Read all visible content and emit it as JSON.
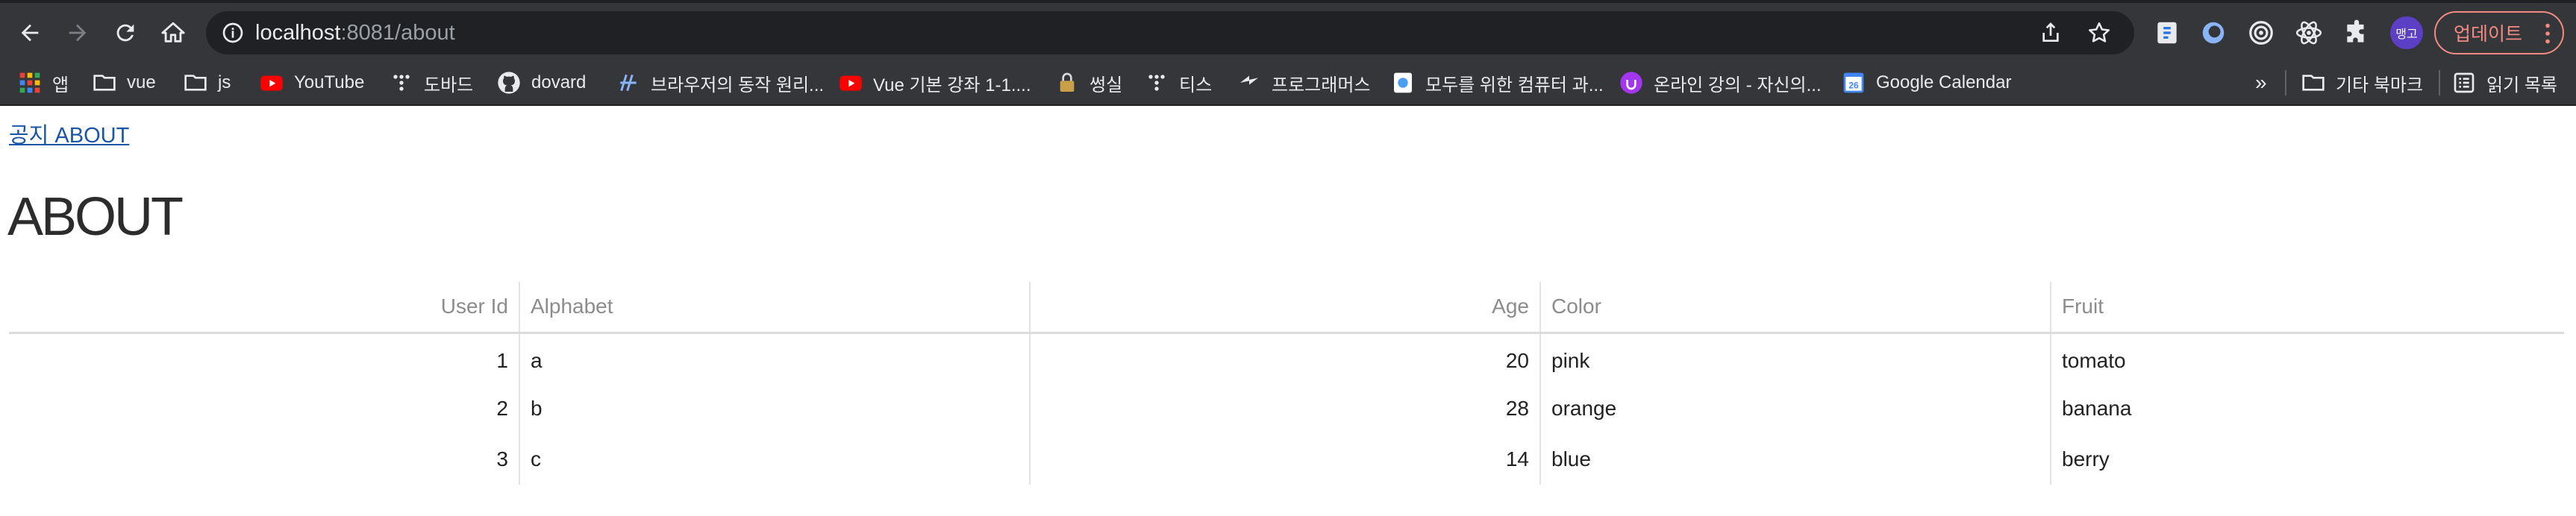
{
  "browser": {
    "url_host": "localhost",
    "url_path": ":8081/about",
    "profile_label": "맹고",
    "update_label": "업데이트",
    "icons": [
      "back-icon",
      "forward-icon",
      "reload-icon",
      "home-icon",
      "info-icon",
      "share-icon",
      "star-icon",
      "puzzle-icon",
      "more-icon"
    ]
  },
  "bookmarks": {
    "items": [
      {
        "label": "앱",
        "icon": "apps-grid-icon"
      },
      {
        "label": "vue",
        "icon": "folder-icon"
      },
      {
        "label": "js",
        "icon": "folder-icon"
      },
      {
        "label": "YouTube",
        "icon": "youtube-icon"
      },
      {
        "label": "도바드",
        "icon": "dots-icon"
      },
      {
        "label": "dovard",
        "icon": "github-icon"
      },
      {
        "label": "브라우저의 동작 원리...",
        "icon": "site-icon"
      },
      {
        "label": "Vue 기본 강좌 1-1....",
        "icon": "youtube-icon"
      },
      {
        "label": "썽실",
        "icon": "lock-icon"
      },
      {
        "label": "티스",
        "icon": "dots-icon"
      },
      {
        "label": "프로그래머스",
        "icon": "programmers-icon"
      },
      {
        "label": "모두를 위한 컴퓨터 과...",
        "icon": "doc-icon"
      },
      {
        "label": "온라인 강의 - 자신의...",
        "icon": "udemy-icon"
      },
      {
        "label": "Google Calendar",
        "icon": "calendar-icon"
      }
    ],
    "overflow": "»",
    "other_label": "기타 북마크",
    "reading_label": "읽기 목록",
    "calendar_day": "26"
  },
  "page": {
    "link_text": "공지 ABOUT",
    "title": "ABOUT"
  },
  "table": {
    "headers": [
      "User Id",
      "Alphabet",
      "Age",
      "Color",
      "Fruit"
    ],
    "rows": [
      [
        "1",
        "a",
        "20",
        "pink",
        "tomato"
      ],
      [
        "2",
        "b",
        "28",
        "orange",
        "banana"
      ],
      [
        "3",
        "c",
        "14",
        "blue",
        "berry"
      ]
    ]
  }
}
